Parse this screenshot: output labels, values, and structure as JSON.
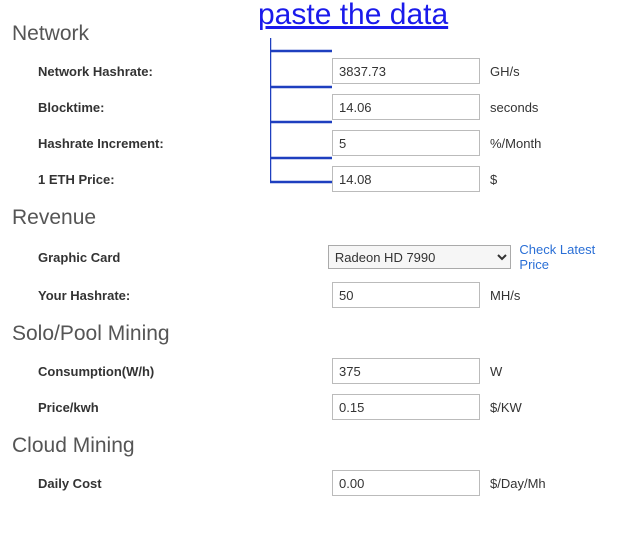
{
  "annotation": "paste the data",
  "sections": {
    "network": {
      "title": "Network",
      "rows": [
        {
          "label": "Network Hashrate:",
          "value": "3837.73",
          "unit": "GH/s"
        },
        {
          "label": "Blocktime:",
          "value": "14.06",
          "unit": "seconds"
        },
        {
          "label": "Hashrate Increment:",
          "value": "5",
          "unit": "%/Month"
        },
        {
          "label": "1 ETH Price:",
          "value": "14.08",
          "unit": "$"
        }
      ]
    },
    "revenue": {
      "title": "Revenue",
      "graphic_card": {
        "label": "Graphic Card",
        "selected": "Radeon HD 7990",
        "check_link": "Check Latest Price"
      },
      "your_hashrate": {
        "label": "Your Hashrate:",
        "value": "50",
        "unit": "MH/s"
      }
    },
    "solo_pool": {
      "title": "Solo/Pool Mining",
      "consumption": {
        "label": "Consumption(W/h)",
        "value": "375",
        "unit": "W"
      },
      "price_kwh": {
        "label": "Price/kwh",
        "value": "0.15",
        "unit": "$/KW"
      }
    },
    "cloud": {
      "title": "Cloud Mining",
      "daily_cost": {
        "label": "Daily Cost",
        "value": "0.00",
        "unit": "$/Day/Mh"
      }
    }
  }
}
